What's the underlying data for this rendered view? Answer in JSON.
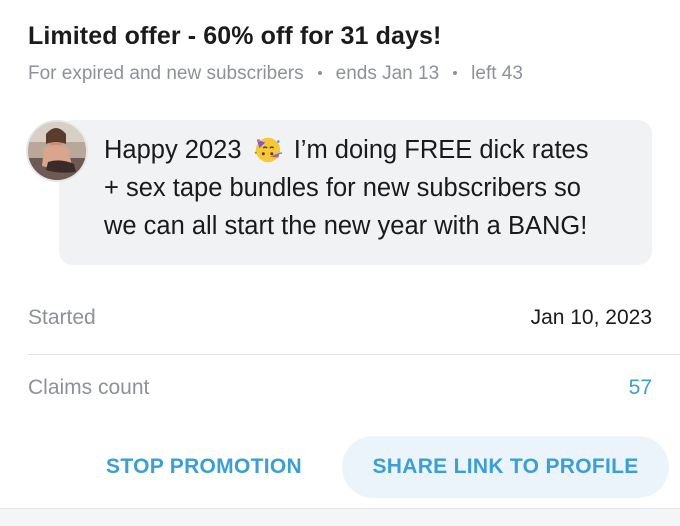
{
  "offer": {
    "title": "Limited offer - 60% off for 31 days!",
    "audience": "For expired and new subscribers",
    "ends": "ends Jan 13",
    "left": "left 43"
  },
  "message": {
    "line1_pre": "Happy 2023",
    "emoji": "partying-face-icon",
    "line1_post": "I’m doing FREE dick rates",
    "line2": "+ sex tape bundles for new subscribers so",
    "line3": "we can all start the new year with a BANG!"
  },
  "stats": {
    "started_label": "Started",
    "started_value": "Jan 10, 2023",
    "claims_label": "Claims count",
    "claims_value": "57"
  },
  "actions": {
    "stop_label": "STOP PROMOTION",
    "share_label": "SHARE LINK TO PROFILE"
  },
  "colors": {
    "accent": "#3a9fd6",
    "muted": "#8d9299",
    "bubble": "#f1f2f4",
    "share_bg": "#ecf4fb"
  }
}
